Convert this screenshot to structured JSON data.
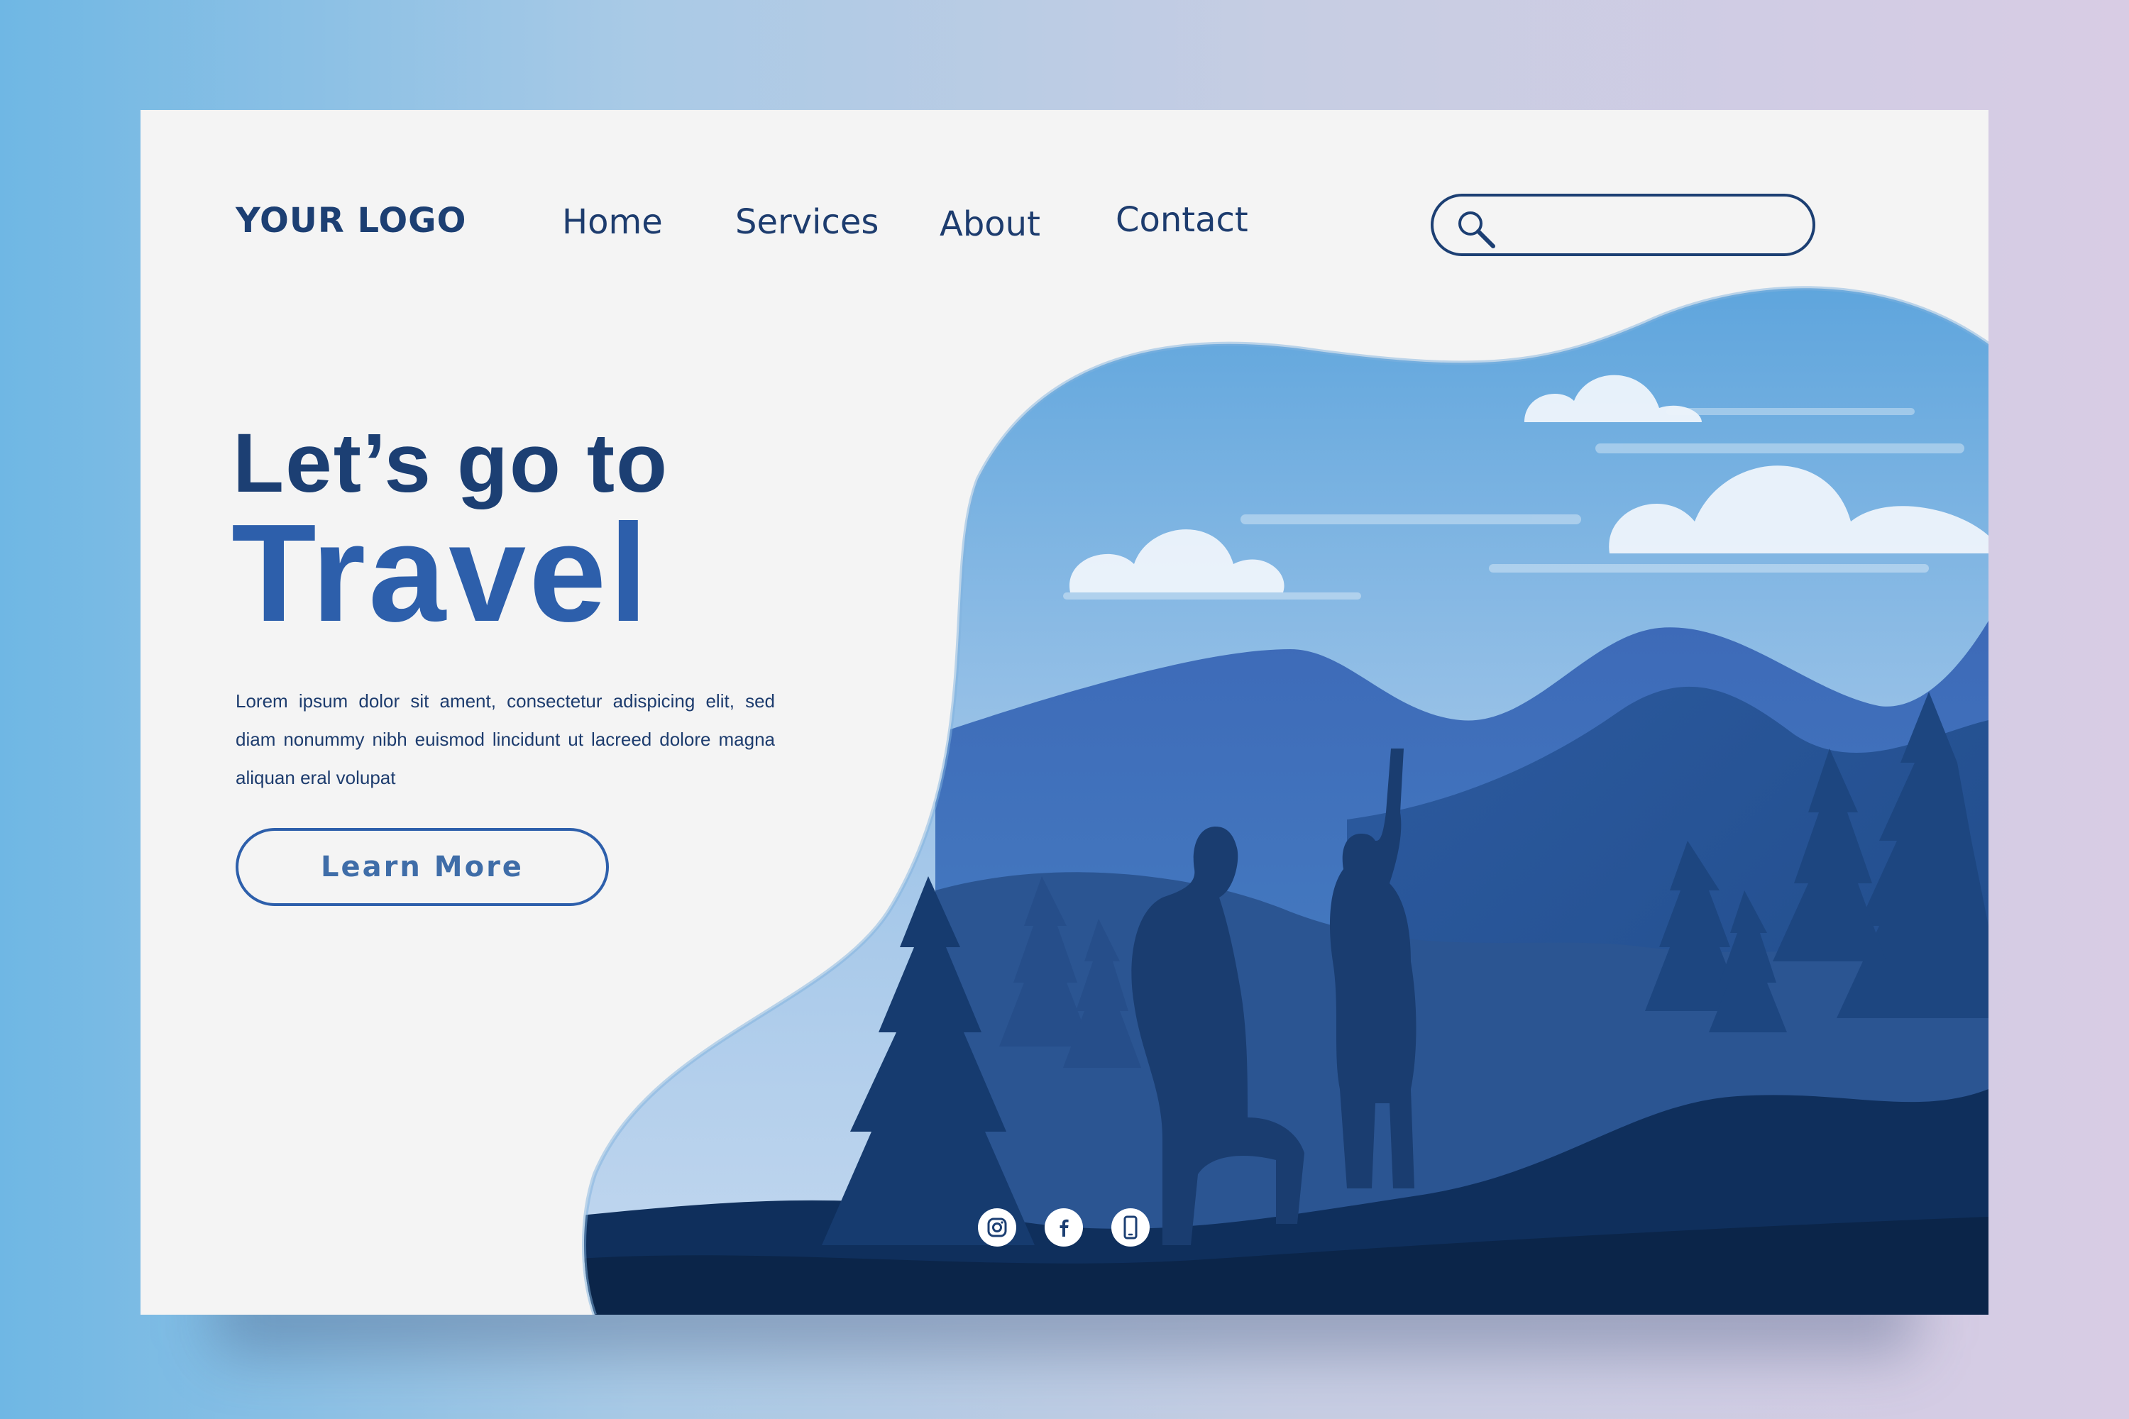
{
  "header": {
    "logo": "YOUR LOGO",
    "nav": [
      "Home",
      "Services",
      "About",
      "Contact"
    ],
    "search": {
      "value": "",
      "placeholder": ""
    }
  },
  "hero": {
    "headline_line1": "Let’s go to",
    "headline_line2": "Travel",
    "body": "Lorem ipsum dolor sit ament, consectetur adispicing elit, sed diam nonummy nibh euismod lincidunt ut lacreed dolore magna aliquan eral volupat",
    "button_label": "Learn More"
  },
  "social": [
    "instagram-icon",
    "facebook-icon",
    "phone-icon"
  ],
  "colors": {
    "primary": "#1c3f73",
    "accent": "#2d5fab",
    "card_bg": "#f4f4f4"
  }
}
